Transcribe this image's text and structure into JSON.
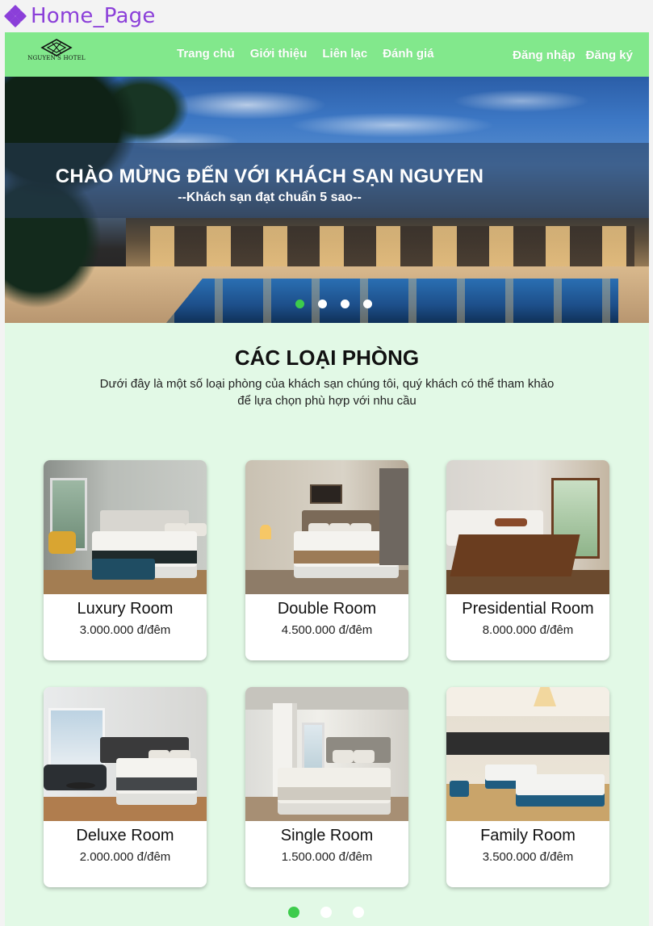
{
  "frame": {
    "title": "Home_Page",
    "icon": "component-icon"
  },
  "nav": {
    "logo_text": "NGUYEN'S HOTEL",
    "links": [
      "Trang chủ",
      "Giới thiệu",
      "Liên lạc",
      "Đánh giá"
    ],
    "login": "Đăng nhập",
    "register": "Đăng ký"
  },
  "hero": {
    "title": "CHÀO MỪNG ĐẾN VỚI KHÁCH SẠN NGUYEN",
    "subtitle": "--Khách sạn đạt chuẩn 5 sao--",
    "slides": 4,
    "active_slide": 0
  },
  "rooms_section": {
    "title": "CÁC LOẠI PHÒNG",
    "description": "Dưới đây là một số loại phòng của khách sạn chúng tôi, quý khách có thể tham khảo để lựa chọn phù hợp với nhu cầu"
  },
  "rooms": [
    {
      "name": "Luxury Room",
      "price": "3.000.000 đ/đêm"
    },
    {
      "name": "Double Room",
      "price": "4.500.000 đ/đêm"
    },
    {
      "name": "Presidential Room",
      "price": "8.000.000 đ/đêm"
    },
    {
      "name": "Deluxe Room",
      "price": "2.000.000 đ/đêm"
    },
    {
      "name": "Single Room",
      "price": "1.500.000 đ/đêm"
    },
    {
      "name": "Family Room",
      "price": "3.500.000 đ/đêm"
    }
  ],
  "room_pager": {
    "pages": 3,
    "active_page": 0
  },
  "colors": {
    "nav_bg": "#82e88c",
    "page_bg": "#e2f9e6",
    "accent": "#3dcc4c",
    "frame_label": "#8b3fd9"
  }
}
